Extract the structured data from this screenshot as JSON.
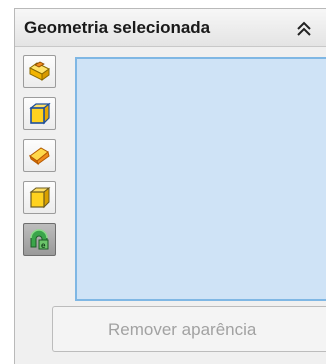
{
  "panel": {
    "title": "Geometria selecionada",
    "collapse_icon": "double-chevron-up-icon"
  },
  "toolbar": {
    "buttons": [
      {
        "icon": "select-parts-icon",
        "active": false
      },
      {
        "icon": "select-bodies-icon",
        "active": false
      },
      {
        "icon": "select-features-icon",
        "active": false
      },
      {
        "icon": "select-faces-icon",
        "active": false
      },
      {
        "icon": "select-surfaces-icon",
        "active": true
      }
    ]
  },
  "selection_list": {
    "items": []
  },
  "actions": {
    "remove_label": "Remover aparência",
    "remove_enabled": false
  },
  "colors": {
    "list_background": "#cfe3f6",
    "list_border": "#7fb7e4",
    "icon_yellow": "#ffd21f",
    "icon_blue": "#1e6fc8",
    "icon_orange": "#f08a1c"
  }
}
